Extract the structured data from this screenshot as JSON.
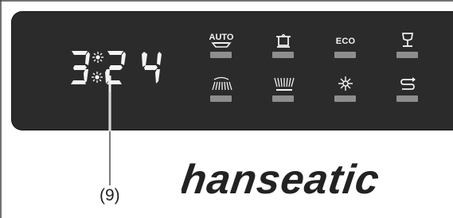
{
  "display": {
    "time_digits": [
      "3",
      "2",
      "4"
    ],
    "annotation_label": "(9)"
  },
  "buttons_top": [
    {
      "id": "auto",
      "label": "AUTO",
      "icon": "auto-program-icon"
    },
    {
      "id": "pot",
      "label": "",
      "icon": "pot-intensive-icon"
    },
    {
      "id": "eco",
      "label": "ECO",
      "icon": "eco-program-icon"
    },
    {
      "id": "glass",
      "label": "",
      "icon": "wine-glass-icon"
    }
  ],
  "buttons_bottom": [
    {
      "id": "spray-quick",
      "label": "",
      "icon": "quick-wash-spray-icon"
    },
    {
      "id": "spray-prewash",
      "label": "",
      "icon": "prewash-spray-icon"
    },
    {
      "id": "hygiene",
      "label": "",
      "icon": "hygiene-sparkle-icon"
    },
    {
      "id": "rinse",
      "label": "",
      "icon": "rinse-arrows-icon"
    }
  ],
  "brand": {
    "name": "hanseatic"
  },
  "colors": {
    "panel": "#2b2b2b",
    "segment": "#f4f4f4",
    "led": "#8e8e8e",
    "page_background": "#ffffff",
    "frame_line": "#444444"
  }
}
